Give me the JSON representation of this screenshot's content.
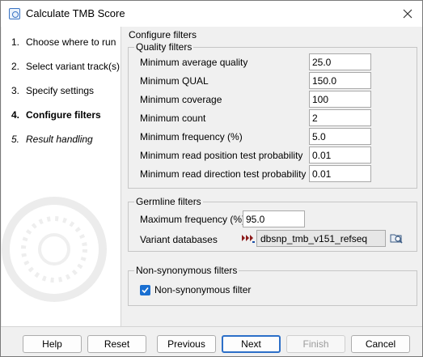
{
  "window": {
    "title": "Calculate TMB Score"
  },
  "steps": [
    {
      "num": "1.",
      "label": "Choose where to run",
      "state": "done"
    },
    {
      "num": "2.",
      "label": "Select variant track(s)",
      "state": "done"
    },
    {
      "num": "3.",
      "label": "Specify settings",
      "state": "done"
    },
    {
      "num": "4.",
      "label": "Configure filters",
      "state": "active"
    },
    {
      "num": "5.",
      "label": "Result handling",
      "state": "future"
    }
  ],
  "content": {
    "title": "Configure filters",
    "quality": {
      "label": "Quality filters",
      "fields": [
        {
          "label": "Minimum average quality",
          "value": "25.0"
        },
        {
          "label": "Minimum QUAL",
          "value": "150.0"
        },
        {
          "label": "Minimum coverage",
          "value": "100"
        },
        {
          "label": "Minimum count",
          "value": "2"
        },
        {
          "label": "Minimum frequency (%)",
          "value": "5.0"
        },
        {
          "label": "Minimum read position test probability",
          "value": "0.01"
        },
        {
          "label": "Minimum read direction test probability",
          "value": "0.01"
        }
      ]
    },
    "germline": {
      "label": "Germline filters",
      "max_freq_label": "Maximum frequency (%)",
      "max_freq_value": "95.0",
      "db_label": "Variant databases",
      "db_value": "dbsnp_tmb_v151_refseq"
    },
    "nonsyn": {
      "label": "Non-synonymous filters",
      "checkbox_label": "Non-synonymous filter",
      "checked": true
    }
  },
  "buttons": {
    "help": "Help",
    "reset": "Reset",
    "previous": "Previous",
    "next": "Next",
    "finish": "Finish",
    "cancel": "Cancel"
  },
  "colors": {
    "accent": "#2c6fc8",
    "checkbox": "#1a6fd1"
  }
}
